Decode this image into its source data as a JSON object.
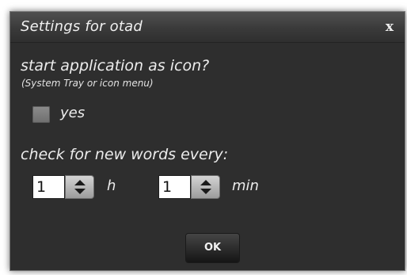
{
  "dialog": {
    "title": "Settings for otad",
    "close_label": "x"
  },
  "icon_setting": {
    "question": "start application as icon?",
    "note": "(System Tray or icon menu)",
    "checkbox_label": "yes",
    "checked": false
  },
  "interval_setting": {
    "question": "check for new words every:",
    "hours_value": "1",
    "hours_unit": "h",
    "minutes_value": "1",
    "minutes_unit": "min"
  },
  "buttons": {
    "ok_label": "OK"
  }
}
